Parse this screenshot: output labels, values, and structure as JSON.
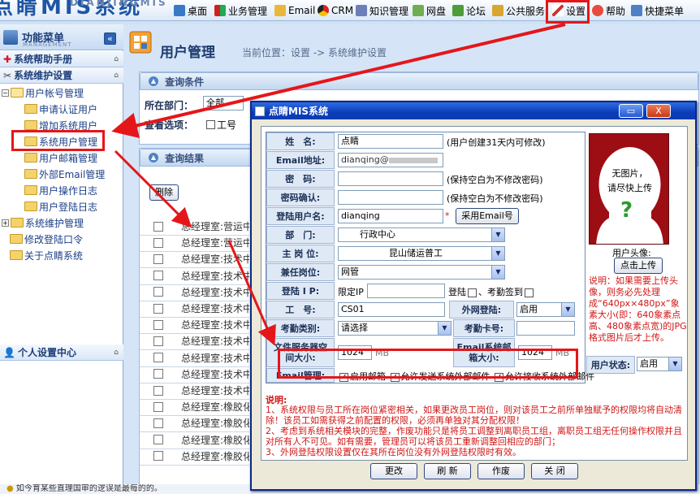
{
  "topbar": {
    "logo_text": "点睛MIS系统",
    "logo_sub": "DIANJINGMIS",
    "menu": [
      "桌面",
      "业务管理",
      "Email",
      "CRM",
      "知识管理",
      "网盘",
      "论坛",
      "公共服务",
      "设置",
      "帮助",
      "快捷菜单"
    ]
  },
  "left": {
    "title": "功能菜单",
    "subtitle": "MANAGEMENT",
    "collapse": "«",
    "sec_help": "系统帮助手册",
    "sec_maint": "系统维护设置",
    "tree": {
      "user_account": "用户帐号管理",
      "apply_cert": "申请认证用户",
      "add_user": "增加系统用户",
      "sys_user_mgmt": "系统用户管理",
      "user_email_mgmt": "用户邮箱管理",
      "ext_email_mgmt": "外部Email管理",
      "user_op_log": "用户操作日志",
      "user_login_log": "用户登陆日志",
      "sys_maint_mgmt": "系统维护管理",
      "change_pwd": "修改登陆口令",
      "about": "关于点睛系统"
    },
    "sec_personal": "个人设置中心"
  },
  "main": {
    "page_title": "用户管理",
    "breadcrumb": "当前位置：设置 -> 系统维护设置",
    "query_header": "查询条件",
    "dept_label": "所在部门：",
    "dept_value": "全部",
    "view_label": "查看选项：",
    "view_opt": "工号",
    "result_header": "查询结果",
    "delete_btn": "删除",
    "rows": [
      "总经理室:营运中心",
      "总经理室:营运中心",
      "总经理室:技术中心",
      "总经理室:技术中心",
      "总经理室:技术中心",
      "总经理室:技术中心",
      "总经理室:技术中心",
      "总经理室:技术中心",
      "总经理室:技术中心",
      "总经理室:技术中心",
      "总经理室:技术中心",
      "总经理室:橡胶化工事业部RL部",
      "总经理室:橡胶化工事业部RL部",
      "总经理室:橡胶化工事业部RL部",
      "总经理室:橡胶化工事业部RL部"
    ],
    "status_text": "如今育某些直理国审的逻误是最每的的。"
  },
  "dialog": {
    "title": "点睛MIS系统",
    "min": "_",
    "close": "X",
    "labels": {
      "name": "姓　名:",
      "email": "Email地址:",
      "pwd": "密　码:",
      "pwd_confirm": "密码确认:",
      "login_name": "登陆用户名:",
      "dept": "部　门:",
      "main_post": "主 岗 位:",
      "extra_post": "兼任岗位:",
      "login_ip": "登陆 I P:",
      "emp_no": "工　号:",
      "ext_login": "外网登陆:",
      "attend_type": "考勤类别:",
      "attend_card": "考勤卡号:",
      "file_space": "文件服务器空间大小:",
      "mailbox_size": "Email系统邮箱大小:",
      "user_status": "用户状态:",
      "email_mgmt": "Email管理:"
    },
    "values": {
      "name": "点睛",
      "email": "dianqing@",
      "login_name": "dianqing",
      "dept": "行政中心",
      "main_post": "昆山储运普工",
      "extra_post": "网管",
      "emp_no": "CS01",
      "ext_login": "启用",
      "attend_type": "请选择",
      "file_space": "1024",
      "mailbox_size": "1024",
      "user_status": "启用",
      "unit": "MB"
    },
    "hints": {
      "name": "(用户创建31天内可修改)",
      "pwd": "(保持空白为不修改密码)",
      "pwd_confirm": "(保持空白为不修改密码)",
      "email_btn": "采用Email号",
      "ip_limit": "限定IP",
      "login_cb": "登陆",
      "attend_cb": "考勤签到",
      "star": "*",
      "enable_mail": "启用邮箱",
      "allow_send": "允许发送系统外部邮件",
      "allow_recv": "允许接收系统外部邮件"
    },
    "photo": {
      "no_photo": "无图片，",
      "please_upload": "请尽快上传",
      "avatar_label": "用户头像:",
      "upload_btn": "点击上传",
      "note": "说明：如果需要上传头像，则务必先处理成“640px×480px”象素大小(即：640象素点高、480象素点宽)的JPG格式图片后才上传。"
    },
    "notes_title": "说明:",
    "notes": [
      "1、系统权限与员工所在岗位紧密相关，如果更改员工岗位，则对该员工之前所单独赋予的权限均将自动清除！该员工如需获得之前配置的权限，必须再单独对其分配权限！",
      "2、考虑到系统相关模块的完整，作废功能只是将员工调整到离职员工组，离职员工组无任何操作权限并且对所有人不可见。如有需要，管理员可以将该员工重新调整回相应的部门；",
      "3、外网登陆权限设置仅在其所在岗位没有外网登陆权限时有效。"
    ],
    "buttons": [
      "更改",
      "刷 新",
      "作废",
      "关 闭"
    ]
  },
  "colors": {
    "highlight": "#e5161a",
    "arrow": "#e5161a",
    "titlebar": "#0b3bb9",
    "photo_bg": "#9c0e14"
  }
}
